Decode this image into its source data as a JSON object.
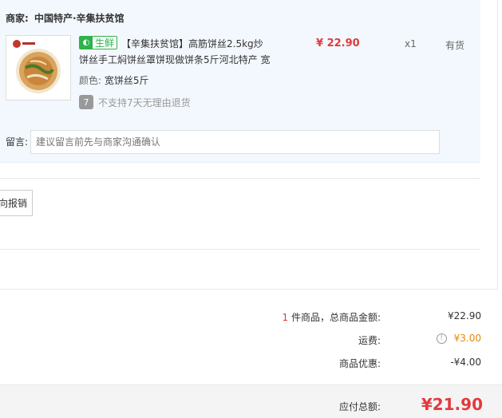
{
  "shop": {
    "label": "商家:",
    "name": "中国特产·辛集扶贫馆"
  },
  "item": {
    "badge_text": "生鲜",
    "badge_icon": "fresh-badge-icon",
    "title_line1": "【辛集扶贫馆】高筋饼丝2.5kg炒",
    "title_line2": "饼丝手工焖饼丝罩饼现做饼条5斤河北特产 宽",
    "price": "¥ 22.90",
    "qty": "x1",
    "stock": "有货",
    "color_key": "颜色:",
    "color_val": "宽饼丝5斤",
    "return_icon_text": "7",
    "return_text": "不支持7天无理由退货"
  },
  "remark": {
    "label": "留言:",
    "placeholder": "建议留言前先与商家沟通确认"
  },
  "invoice": {
    "button_label": "向报销"
  },
  "summary": {
    "count": "1",
    "count_label": "件商品，总商品金额:",
    "goods_total": "¥22.90",
    "shipping_label": "运费:",
    "shipping_value": "¥3.00",
    "discount_label": "商品优惠:",
    "discount_value": "-¥4.00",
    "payable_label": "应付总额:",
    "payable_value": "¥21.90"
  },
  "colors": {
    "accent_red": "#e4393c",
    "fresh_green": "#2db34a",
    "shipping_orange": "#e48a00",
    "panel_bg": "#f3f8fe"
  }
}
